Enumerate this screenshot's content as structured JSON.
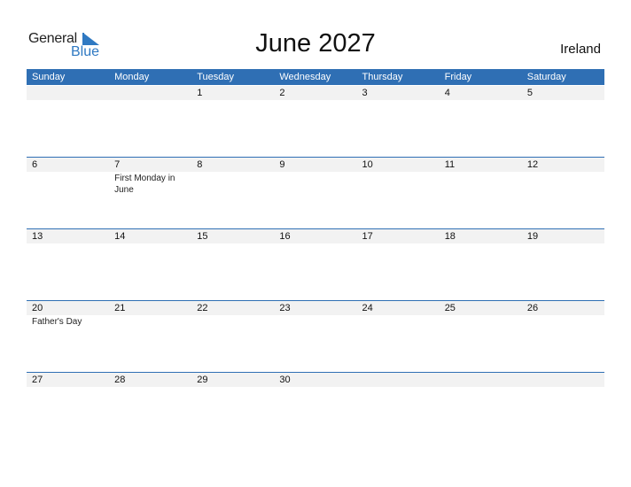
{
  "logo": {
    "general": "General",
    "blue": "Blue"
  },
  "title": "June 2027",
  "country": "Ireland",
  "colors": {
    "accent": "#2f6fb4",
    "band": "#f2f2f2"
  },
  "weekdays": [
    "Sunday",
    "Monday",
    "Tuesday",
    "Wednesday",
    "Thursday",
    "Friday",
    "Saturday"
  ],
  "weeks": [
    [
      {
        "day": ""
      },
      {
        "day": ""
      },
      {
        "day": "1"
      },
      {
        "day": "2"
      },
      {
        "day": "3"
      },
      {
        "day": "4"
      },
      {
        "day": "5"
      }
    ],
    [
      {
        "day": "6"
      },
      {
        "day": "7",
        "event": "First Monday in June"
      },
      {
        "day": "8"
      },
      {
        "day": "9"
      },
      {
        "day": "10"
      },
      {
        "day": "11"
      },
      {
        "day": "12"
      }
    ],
    [
      {
        "day": "13"
      },
      {
        "day": "14"
      },
      {
        "day": "15"
      },
      {
        "day": "16"
      },
      {
        "day": "17"
      },
      {
        "day": "18"
      },
      {
        "day": "19"
      }
    ],
    [
      {
        "day": "20",
        "event": "Father's Day"
      },
      {
        "day": "21"
      },
      {
        "day": "22"
      },
      {
        "day": "23"
      },
      {
        "day": "24"
      },
      {
        "day": "25"
      },
      {
        "day": "26"
      }
    ],
    [
      {
        "day": "27"
      },
      {
        "day": "28"
      },
      {
        "day": "29"
      },
      {
        "day": "30"
      },
      {
        "day": ""
      },
      {
        "day": ""
      },
      {
        "day": ""
      }
    ]
  ]
}
